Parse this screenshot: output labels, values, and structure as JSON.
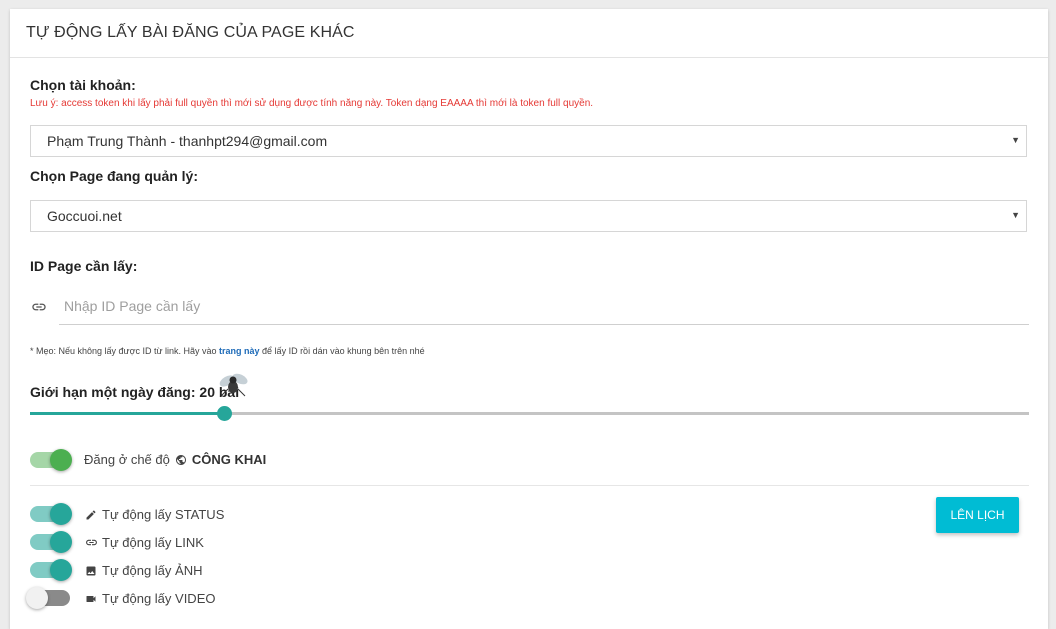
{
  "header": {
    "title": "TỰ ĐỘNG LẤY BÀI ĐĂNG CỦA PAGE KHÁC"
  },
  "account": {
    "label": "Chọn tài khoản:",
    "warning": "Lưu ý: access token khi lấy phải full quyền thì mới sử dụng được tính năng này. Token dạng EAAAA thì mới là token full quyền.",
    "selected": "Phạm Trung Thành - thanhpt294@gmail.com"
  },
  "page": {
    "label": "Chọn Page đang quản lý:",
    "selected": "Goccuoi.net"
  },
  "id_page": {
    "label": "ID Page cần lấy:",
    "placeholder": "Nhập ID Page cần lấy"
  },
  "tip": {
    "prefix": "* Mẹo: Nếu không lấy được ID từ link. Hãy vào ",
    "link": "trang này",
    "suffix": " để lấy ID rồi dán vào khung bên trên nhé"
  },
  "limit": {
    "label": "Giới hạn một ngày đăng: 20 bài",
    "value": 20,
    "fraction": 0.195
  },
  "privacy": {
    "prefix": "Đăng ở chế độ",
    "mode": "CÔNG KHAI",
    "on": true
  },
  "options": [
    {
      "label": "Tự động lấy STATUS",
      "icon": "pencil-icon",
      "on": true
    },
    {
      "label": "Tự động lấy LINK",
      "icon": "link-icon",
      "on": true
    },
    {
      "label": "Tự động lấy ẢNH",
      "icon": "image-icon",
      "on": true
    },
    {
      "label": "Tự động lấy VIDEO",
      "icon": "video-icon",
      "on": false
    }
  ],
  "schedule_button": "LÊN LỊCH",
  "colors": {
    "accent": "#26a69a",
    "button": "#00bcd4",
    "warning": "#e53935",
    "link": "#1e6bb8"
  }
}
